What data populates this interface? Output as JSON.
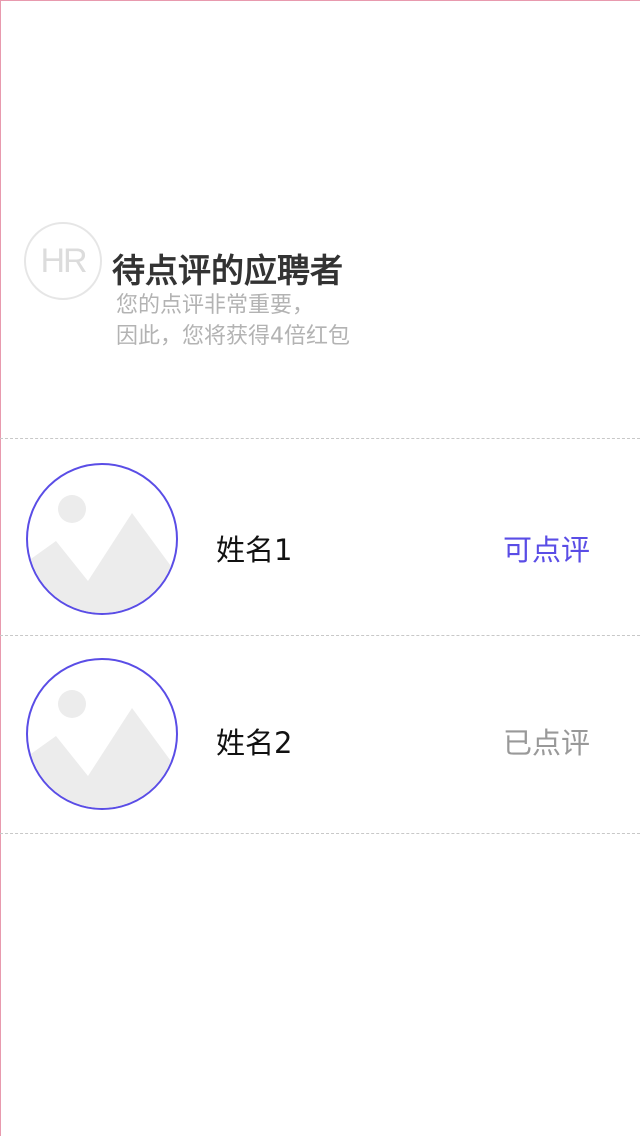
{
  "header": {
    "logo_text": "HR",
    "title": "待点评的应聘者",
    "subtitle_line1": "您的点评非常重要，",
    "subtitle_line2": "因此，您将获得4倍红包"
  },
  "candidates": [
    {
      "name": "姓名1",
      "status": "可点评",
      "status_color": "#5a4de6",
      "avatar_icon": "image-placeholder-icon"
    },
    {
      "name": "姓名2",
      "status": "已点评",
      "status_color": "#999999",
      "avatar_icon": "image-placeholder-icon"
    }
  ],
  "colors": {
    "accent": "#5a4de6",
    "divider": "#c8c8c8",
    "title": "#333333",
    "subtitle": "#b3b3b3"
  }
}
